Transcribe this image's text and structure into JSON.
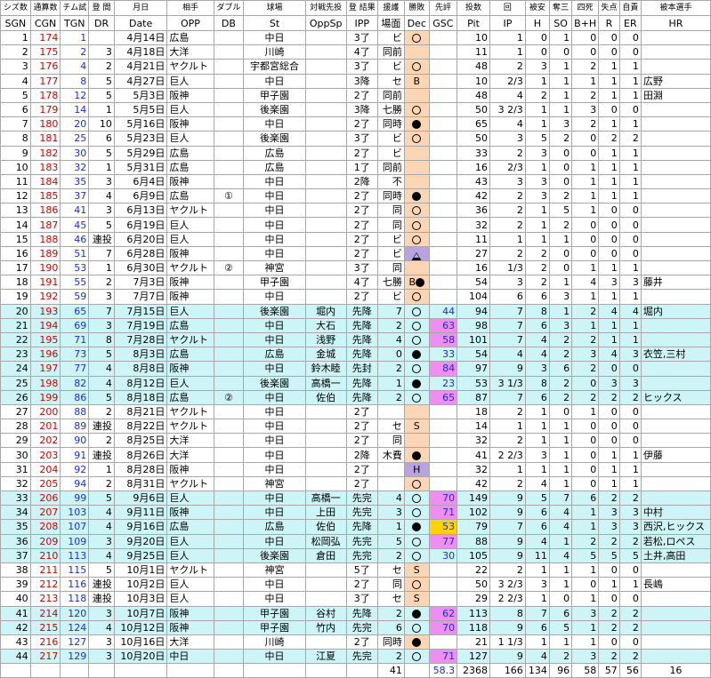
{
  "headers_top": [
    "シズ数",
    "通算数",
    "チム試",
    "登 間",
    "月日",
    "相手",
    "ダブル",
    "球場",
    "対戦先投",
    "登 結果",
    "援護",
    "勝敗",
    "先評",
    "投数",
    "回",
    "被安",
    "奪三",
    "四死",
    "失点",
    "自責",
    "被本選手"
  ],
  "headers": [
    "SGN",
    "CGN",
    "TGN",
    "DR",
    "Date",
    "OPP",
    "DB",
    "St",
    "OppSp",
    "IPP",
    "場面",
    "Dec",
    "GSC",
    "Pit",
    "IP",
    "H",
    "SO",
    "B+H",
    "R",
    "ER",
    "HR"
  ],
  "rows": [
    {
      "sgn": "1",
      "cgn": "174",
      "tgn": "1",
      "dr": "",
      "date": "4月14日",
      "opp": "広島",
      "db": "",
      "st": "中日",
      "oppsp": "",
      "ipp": "3了",
      "scene": "ビ",
      "dec": "loss",
      "gsc": "",
      "gcls": "",
      "pit": "10",
      "ip": "1",
      "h": "0",
      "so": "1",
      "bh": "0",
      "r": "0",
      "er": "0",
      "hr": "",
      "blue": false
    },
    {
      "sgn": "2",
      "cgn": "175",
      "tgn": "2",
      "dr": "3",
      "date": "4月18日",
      "opp": "大洋",
      "db": "",
      "st": "川崎",
      "oppsp": "",
      "ipp": "4了",
      "scene": "同前",
      "dec": "",
      "gsc": "",
      "gcls": "",
      "pit": "11",
      "ip": "1",
      "h": "0",
      "so": "0",
      "bh": "0",
      "r": "0",
      "er": "0",
      "hr": "",
      "blue": false
    },
    {
      "sgn": "3",
      "cgn": "176",
      "tgn": "4",
      "dr": "2",
      "date": "4月21日",
      "opp": "ヤクルト",
      "db": "",
      "st": "宇都宮総合",
      "oppsp": "",
      "ipp": "3了",
      "scene": "ビ",
      "dec": "loss",
      "gsc": "",
      "gcls": "",
      "pit": "48",
      "ip": "2",
      "h": "3",
      "so": "1",
      "bh": "2",
      "r": "1",
      "er": "1",
      "hr": "",
      "blue": false
    },
    {
      "sgn": "4",
      "cgn": "177",
      "tgn": "8",
      "dr": "5",
      "date": "4月27日",
      "opp": "巨人",
      "db": "",
      "st": "中日",
      "oppsp": "",
      "ipp": "3降",
      "scene": "セ",
      "dec": "B",
      "gsc": "",
      "gcls": "",
      "pit": "10",
      "ip": "2/3",
      "h": "1",
      "so": "1",
      "bh": "1",
      "r": "1",
      "er": "1",
      "hr": "広野",
      "blue": false
    },
    {
      "sgn": "5",
      "cgn": "178",
      "tgn": "12",
      "dr": "5",
      "date": "5月3日",
      "opp": "阪神",
      "db": "",
      "st": "甲子園",
      "oppsp": "",
      "ipp": "2了",
      "scene": "同前",
      "dec": "",
      "gsc": "",
      "gcls": "",
      "pit": "48",
      "ip": "4",
      "h": "2",
      "so": "1",
      "bh": "2",
      "r": "1",
      "er": "1",
      "hr": "田淵",
      "blue": false
    },
    {
      "sgn": "6",
      "cgn": "179",
      "tgn": "14",
      "dr": "1",
      "date": "5月5日",
      "opp": "巨人",
      "db": "",
      "st": "後楽園",
      "oppsp": "",
      "ipp": "3降",
      "scene": "七勝",
      "dec": "loss",
      "gsc": "",
      "gcls": "",
      "pit": "50",
      "ip": "3 2/3",
      "h": "1",
      "so": "1",
      "bh": "3",
      "r": "0",
      "er": "0",
      "hr": "",
      "blue": false
    },
    {
      "sgn": "7",
      "cgn": "180",
      "tgn": "20",
      "dr": "10",
      "date": "5月16日",
      "opp": "阪神",
      "db": "",
      "st": "中日",
      "oppsp": "",
      "ipp": "2了",
      "scene": "同時",
      "dec": "win",
      "gsc": "",
      "gcls": "",
      "pit": "65",
      "ip": "4",
      "h": "1",
      "so": "3",
      "bh": "2",
      "r": "1",
      "er": "1",
      "hr": "",
      "blue": false
    },
    {
      "sgn": "8",
      "cgn": "181",
      "tgn": "25",
      "dr": "6",
      "date": "5月23日",
      "opp": "巨人",
      "db": "",
      "st": "後楽園",
      "oppsp": "",
      "ipp": "3了",
      "scene": "ビ",
      "dec": "loss",
      "gsc": "",
      "gcls": "",
      "pit": "50",
      "ip": "3",
      "h": "5",
      "so": "2",
      "bh": "0",
      "r": "2",
      "er": "2",
      "hr": "",
      "blue": false
    },
    {
      "sgn": "9",
      "cgn": "182",
      "tgn": "30",
      "dr": "5",
      "date": "5月29日",
      "opp": "広島",
      "db": "",
      "st": "広島",
      "oppsp": "",
      "ipp": "2了",
      "scene": "ビ",
      "dec": "",
      "gsc": "",
      "gcls": "",
      "pit": "33",
      "ip": "2",
      "h": "3",
      "so": "0",
      "bh": "0",
      "r": "1",
      "er": "1",
      "hr": "",
      "blue": false
    },
    {
      "sgn": "10",
      "cgn": "183",
      "tgn": "32",
      "dr": "1",
      "date": "5月31日",
      "opp": "広島",
      "db": "",
      "st": "広島",
      "oppsp": "",
      "ipp": "1了",
      "scene": "同前",
      "dec": "",
      "gsc": "",
      "gcls": "",
      "pit": "16",
      "ip": "2/3",
      "h": "1",
      "so": "0",
      "bh": "1",
      "r": "1",
      "er": "1",
      "hr": "",
      "blue": false
    },
    {
      "sgn": "11",
      "cgn": "184",
      "tgn": "35",
      "dr": "3",
      "date": "6月4日",
      "opp": "阪神",
      "db": "",
      "st": "中日",
      "oppsp": "",
      "ipp": "2降",
      "scene": "不",
      "dec": "",
      "gsc": "",
      "gcls": "",
      "pit": "43",
      "ip": "3",
      "h": "3",
      "so": "0",
      "bh": "1",
      "r": "1",
      "er": "1",
      "hr": "",
      "blue": false
    },
    {
      "sgn": "12",
      "cgn": "185",
      "tgn": "37",
      "dr": "4",
      "date": "6月9日",
      "opp": "広島",
      "db": "①",
      "st": "中日",
      "oppsp": "",
      "ipp": "2了",
      "scene": "同時",
      "dec": "win",
      "gsc": "",
      "gcls": "",
      "pit": "42",
      "ip": "2",
      "h": "3",
      "so": "2",
      "bh": "1",
      "r": "1",
      "er": "1",
      "hr": "",
      "blue": false
    },
    {
      "sgn": "13",
      "cgn": "186",
      "tgn": "41",
      "dr": "3",
      "date": "6月13日",
      "opp": "ヤクルト",
      "db": "",
      "st": "中日",
      "oppsp": "",
      "ipp": "2了",
      "scene": "同",
      "dec": "loss",
      "gsc": "",
      "gcls": "",
      "pit": "36",
      "ip": "2",
      "h": "1",
      "so": "5",
      "bh": "1",
      "r": "0",
      "er": "0",
      "hr": "",
      "blue": false
    },
    {
      "sgn": "14",
      "cgn": "187",
      "tgn": "45",
      "dr": "5",
      "date": "6月19日",
      "opp": "巨人",
      "db": "",
      "st": "中日",
      "oppsp": "",
      "ipp": "2了",
      "scene": "同",
      "dec": "loss",
      "gsc": "",
      "gcls": "",
      "pit": "32",
      "ip": "2",
      "h": "1",
      "so": "2",
      "bh": "0",
      "r": "0",
      "er": "0",
      "hr": "",
      "blue": false
    },
    {
      "sgn": "15",
      "cgn": "188",
      "tgn": "46",
      "dr": "連投",
      "date": "6月20日",
      "opp": "巨人",
      "db": "",
      "st": "中日",
      "oppsp": "",
      "ipp": "2了",
      "scene": "ビ",
      "dec": "loss",
      "gsc": "",
      "gcls": "",
      "pit": "11",
      "ip": "1",
      "h": "1",
      "so": "1",
      "bh": "0",
      "r": "0",
      "er": "0",
      "hr": "",
      "blue": false
    },
    {
      "sgn": "16",
      "cgn": "189",
      "tgn": "51",
      "dr": "7",
      "date": "6月28日",
      "opp": "阪神",
      "db": "",
      "st": "中日",
      "oppsp": "",
      "ipp": "2了",
      "scene": "ビ",
      "dec": "draw",
      "gsc": "",
      "gcls": "",
      "pit": "27",
      "ip": "2",
      "h": "2",
      "so": "0",
      "bh": "0",
      "r": "0",
      "er": "0",
      "hr": "",
      "blue": false
    },
    {
      "sgn": "17",
      "cgn": "190",
      "tgn": "53",
      "dr": "1",
      "date": "6月30日",
      "opp": "ヤクルト",
      "db": "②",
      "st": "神宮",
      "oppsp": "",
      "ipp": "3了",
      "scene": "同",
      "dec": "",
      "gsc": "",
      "gcls": "",
      "pit": "16",
      "ip": "1/3",
      "h": "2",
      "so": "0",
      "bh": "1",
      "r": "1",
      "er": "1",
      "hr": "",
      "blue": false
    },
    {
      "sgn": "18",
      "cgn": "191",
      "tgn": "55",
      "dr": "2",
      "date": "7月3日",
      "opp": "阪神",
      "db": "",
      "st": "甲子園",
      "oppsp": "",
      "ipp": "4了",
      "scene": "七勝",
      "dec": "Bwin",
      "gsc": "",
      "gcls": "",
      "pit": "54",
      "ip": "3",
      "h": "2",
      "so": "1",
      "bh": "4",
      "r": "3",
      "er": "3",
      "hr": "藤井",
      "blue": false
    },
    {
      "sgn": "19",
      "cgn": "192",
      "tgn": "59",
      "dr": "3",
      "date": "7月7日",
      "opp": "阪神",
      "db": "",
      "st": "中日",
      "oppsp": "",
      "ipp": "2了",
      "scene": "ビ",
      "dec": "loss",
      "gsc": "",
      "gcls": "",
      "pit": "104",
      "ip": "6",
      "h": "6",
      "so": "3",
      "bh": "1",
      "r": "1",
      "er": "1",
      "hr": "",
      "blue": false
    },
    {
      "sgn": "20",
      "cgn": "193",
      "tgn": "65",
      "dr": "7",
      "date": "7月15日",
      "opp": "巨人",
      "db": "",
      "st": "後楽園",
      "oppsp": "堀内",
      "ipp": "先降",
      "scene": "7",
      "dec": "loss",
      "gsc": "44",
      "gcls": "",
      "pit": "94",
      "ip": "7",
      "h": "8",
      "so": "1",
      "bh": "2",
      "r": "4",
      "er": "4",
      "hr": "堀内",
      "blue": true
    },
    {
      "sgn": "21",
      "cgn": "194",
      "tgn": "69",
      "dr": "3",
      "date": "7月19日",
      "opp": "広島",
      "db": "",
      "st": "中日",
      "oppsp": "大石",
      "ipp": "先降",
      "scene": "2",
      "dec": "loss",
      "gsc": "63",
      "gcls": "m",
      "pit": "98",
      "ip": "7",
      "h": "6",
      "so": "3",
      "bh": "1",
      "r": "1",
      "er": "1",
      "hr": "",
      "blue": true
    },
    {
      "sgn": "22",
      "cgn": "195",
      "tgn": "71",
      "dr": "8",
      "date": "7月28日",
      "opp": "ヤクルト",
      "db": "",
      "st": "中日",
      "oppsp": "浅野",
      "ipp": "先降",
      "scene": "4",
      "dec": "loss",
      "gsc": "58",
      "gcls": "m",
      "pit": "101",
      "ip": "7",
      "h": "4",
      "so": "2",
      "bh": "2",
      "r": "1",
      "er": "1",
      "hr": "",
      "blue": true
    },
    {
      "sgn": "23",
      "cgn": "196",
      "tgn": "73",
      "dr": "5",
      "date": "8月3日",
      "opp": "広島",
      "db": "",
      "st": "広島",
      "oppsp": "金城",
      "ipp": "先降",
      "scene": "0",
      "dec": "win",
      "gsc": "33",
      "gcls": "",
      "pit": "54",
      "ip": "4",
      "h": "4",
      "so": "2",
      "bh": "3",
      "r": "4",
      "er": "3",
      "hr": "衣笠,三村",
      "blue": true
    },
    {
      "sgn": "24",
      "cgn": "197",
      "tgn": "77",
      "dr": "4",
      "date": "8月8日",
      "opp": "阪神",
      "db": "",
      "st": "中日",
      "oppsp": "鈴木睦",
      "ipp": "先封",
      "scene": "2",
      "dec": "loss",
      "gsc": "84",
      "gcls": "m",
      "pit": "97",
      "ip": "9",
      "h": "3",
      "so": "6",
      "bh": "2",
      "r": "0",
      "er": "0",
      "hr": "",
      "blue": true
    },
    {
      "sgn": "25",
      "cgn": "198",
      "tgn": "82",
      "dr": "4",
      "date": "8月12日",
      "opp": "巨人",
      "db": "",
      "st": "後楽園",
      "oppsp": "高橋一",
      "ipp": "先降",
      "scene": "1",
      "dec": "win",
      "gsc": "23",
      "gcls": "",
      "pit": "53",
      "ip": "3 1/3",
      "h": "8",
      "so": "2",
      "bh": "0",
      "r": "3",
      "er": "3",
      "hr": "",
      "blue": true
    },
    {
      "sgn": "26",
      "cgn": "199",
      "tgn": "86",
      "dr": "5",
      "date": "8月18日",
      "opp": "広島",
      "db": "②",
      "st": "中日",
      "oppsp": "佐伯",
      "ipp": "先降",
      "scene": "2",
      "dec": "loss",
      "gsc": "65",
      "gcls": "m",
      "pit": "87",
      "ip": "7",
      "h": "6",
      "so": "2",
      "bh": "2",
      "r": "2",
      "er": "2",
      "hr": "ヒックス",
      "blue": true
    },
    {
      "sgn": "27",
      "cgn": "200",
      "tgn": "88",
      "dr": "2",
      "date": "8月21日",
      "opp": "ヤクルト",
      "db": "",
      "st": "中日",
      "oppsp": "",
      "ipp": "2了",
      "scene": "",
      "dec": "",
      "gsc": "",
      "gcls": "",
      "pit": "18",
      "ip": "2",
      "h": "1",
      "so": "0",
      "bh": "1",
      "r": "0",
      "er": "0",
      "hr": "",
      "blue": false
    },
    {
      "sgn": "28",
      "cgn": "201",
      "tgn": "89",
      "dr": "連投",
      "date": "8月22日",
      "opp": "ヤクルト",
      "db": "",
      "st": "中日",
      "oppsp": "",
      "ipp": "2了",
      "scene": "セ",
      "dec": "S",
      "gsc": "",
      "gcls": "",
      "pit": "14",
      "ip": "1",
      "h": "1",
      "so": "1",
      "bh": "0",
      "r": "0",
      "er": "0",
      "hr": "",
      "blue": false
    },
    {
      "sgn": "29",
      "cgn": "202",
      "tgn": "90",
      "dr": "2",
      "date": "8月25日",
      "opp": "大洋",
      "db": "",
      "st": "中日",
      "oppsp": "",
      "ipp": "2了",
      "scene": "同",
      "dec": "",
      "gsc": "",
      "gcls": "",
      "pit": "32",
      "ip": "2",
      "h": "1",
      "so": "1",
      "bh": "0",
      "r": "0",
      "er": "0",
      "hr": "",
      "blue": false
    },
    {
      "sgn": "30",
      "cgn": "203",
      "tgn": "91",
      "dr": "連投",
      "date": "8月26日",
      "opp": "大洋",
      "db": "",
      "st": "中日",
      "oppsp": "",
      "ipp": "2降",
      "scene": "木費",
      "dec": "win",
      "gsc": "",
      "gcls": "",
      "pit": "41",
      "ip": "2 2/3",
      "h": "3",
      "so": "1",
      "bh": "0",
      "r": "1",
      "er": "1",
      "hr": "伊藤",
      "blue": false
    },
    {
      "sgn": "31",
      "cgn": "204",
      "tgn": "92",
      "dr": "1",
      "date": "8月28日",
      "opp": "阪神",
      "db": "",
      "st": "中日",
      "oppsp": "",
      "ipp": "2了",
      "scene": "",
      "dec": "H",
      "gsc": "",
      "gcls": "",
      "pit": "32",
      "ip": "1",
      "h": "1",
      "so": "1",
      "bh": "0",
      "r": "1",
      "er": "1",
      "hr": "",
      "blue": false
    },
    {
      "sgn": "32",
      "cgn": "205",
      "tgn": "94",
      "dr": "2",
      "date": "8月31日",
      "opp": "ヤクルト",
      "db": "",
      "st": "神宮",
      "oppsp": "",
      "ipp": "2了",
      "scene": "",
      "dec": "loss",
      "gsc": "",
      "gcls": "",
      "pit": "42",
      "ip": "2",
      "h": "4",
      "so": "1",
      "bh": "0",
      "r": "1",
      "er": "1",
      "hr": "",
      "blue": false
    },
    {
      "sgn": "33",
      "cgn": "206",
      "tgn": "99",
      "dr": "5",
      "date": "9月6日",
      "opp": "巨人",
      "db": "",
      "st": "中日",
      "oppsp": "高橋一",
      "ipp": "先完",
      "scene": "4",
      "dec": "loss",
      "gsc": "70",
      "gcls": "m",
      "pit": "149",
      "ip": "9",
      "h": "5",
      "so": "7",
      "bh": "6",
      "r": "2",
      "er": "2",
      "hr": "",
      "blue": true
    },
    {
      "sgn": "34",
      "cgn": "207",
      "tgn": "103",
      "dr": "4",
      "date": "9月11日",
      "opp": "阪神",
      "db": "",
      "st": "中日",
      "oppsp": "上田",
      "ipp": "先完",
      "scene": "3",
      "dec": "loss",
      "gsc": "71",
      "gcls": "m",
      "pit": "102",
      "ip": "9",
      "h": "6",
      "so": "4",
      "bh": "1",
      "r": "3",
      "er": "3",
      "hr": "中村",
      "blue": true
    },
    {
      "sgn": "35",
      "cgn": "208",
      "tgn": "107",
      "dr": "4",
      "date": "9月16日",
      "opp": "広島",
      "db": "",
      "st": "広島",
      "oppsp": "佐伯",
      "ipp": "先降",
      "scene": "1",
      "dec": "win",
      "gsc": "53",
      "gcls": "y",
      "pit": "79",
      "ip": "7",
      "h": "6",
      "so": "4",
      "bh": "1",
      "r": "3",
      "er": "3",
      "hr": "西沢,ヒックス",
      "blue": true
    },
    {
      "sgn": "36",
      "cgn": "209",
      "tgn": "109",
      "dr": "3",
      "date": "9月20日",
      "opp": "巨人",
      "db": "",
      "st": "中日",
      "oppsp": "松岡弘",
      "ipp": "先完",
      "scene": "5",
      "dec": "loss",
      "gsc": "77",
      "gcls": "m",
      "pit": "88",
      "ip": "9",
      "h": "4",
      "so": "1",
      "bh": "2",
      "r": "2",
      "er": "2",
      "hr": "若松,ロペス",
      "blue": true
    },
    {
      "sgn": "37",
      "cgn": "210",
      "tgn": "113",
      "dr": "4",
      "date": "9月25日",
      "opp": "巨人",
      "db": "",
      "st": "後楽園",
      "oppsp": "倉田",
      "ipp": "先完",
      "scene": "2",
      "dec": "loss",
      "gsc": "30",
      "gcls": "",
      "pit": "105",
      "ip": "9",
      "h": "11",
      "so": "4",
      "bh": "5",
      "r": "5",
      "er": "5",
      "hr": "土井,高田",
      "blue": true
    },
    {
      "sgn": "38",
      "cgn": "211",
      "tgn": "115",
      "dr": "5",
      "date": "10月1日",
      "opp": "ヤクルト",
      "db": "",
      "st": "神宮",
      "oppsp": "",
      "ipp": "5了",
      "scene": "セ",
      "dec": "S",
      "gsc": "",
      "gcls": "",
      "pit": "22",
      "ip": "2",
      "h": "1",
      "so": "1",
      "bh": "1",
      "r": "0",
      "er": "0",
      "hr": "",
      "blue": false
    },
    {
      "sgn": "39",
      "cgn": "212",
      "tgn": "116",
      "dr": "連投",
      "date": "10月2日",
      "opp": "巨人",
      "db": "",
      "st": "中日",
      "oppsp": "",
      "ipp": "2了",
      "scene": "同",
      "dec": "loss",
      "gsc": "",
      "gcls": "",
      "pit": "50",
      "ip": "3 2/3",
      "h": "3",
      "so": "1",
      "bh": "0",
      "r": "1",
      "er": "1",
      "hr": "長嶋",
      "blue": false
    },
    {
      "sgn": "40",
      "cgn": "213",
      "tgn": "118",
      "dr": "連投",
      "date": "10月3日",
      "opp": "巨人",
      "db": "",
      "st": "中日",
      "oppsp": "",
      "ipp": "3了",
      "scene": "セ",
      "dec": "S",
      "gsc": "",
      "gcls": "",
      "pit": "29",
      "ip": "2 2/3",
      "h": "1",
      "so": "0",
      "bh": "1",
      "r": "0",
      "er": "0",
      "hr": "",
      "blue": false
    },
    {
      "sgn": "41",
      "cgn": "214",
      "tgn": "120",
      "dr": "3",
      "date": "10月7日",
      "opp": "阪神",
      "db": "",
      "st": "甲子園",
      "oppsp": "谷村",
      "ipp": "先降",
      "scene": "2",
      "dec": "win",
      "gsc": "62",
      "gcls": "m",
      "pit": "113",
      "ip": "8",
      "h": "7",
      "so": "6",
      "bh": "3",
      "r": "2",
      "er": "2",
      "hr": "",
      "blue": true
    },
    {
      "sgn": "42",
      "cgn": "215",
      "tgn": "124",
      "dr": "4",
      "date": "10月12日",
      "opp": "阪神",
      "db": "",
      "st": "甲子園",
      "oppsp": "竹内",
      "ipp": "先完",
      "scene": "6",
      "dec": "loss",
      "gsc": "70",
      "gcls": "m",
      "pit": "118",
      "ip": "9",
      "h": "6",
      "so": "5",
      "bh": "1",
      "r": "2",
      "er": "2",
      "hr": "",
      "blue": true
    },
    {
      "sgn": "43",
      "cgn": "216",
      "tgn": "127",
      "dr": "3",
      "date": "10月16日",
      "opp": "大洋",
      "db": "",
      "st": "川崎",
      "oppsp": "",
      "ipp": "2了",
      "scene": "同時",
      "dec": "win",
      "gsc": "",
      "gcls": "",
      "pit": "21",
      "ip": "1 1/3",
      "h": "1",
      "so": "1",
      "bh": "1",
      "r": "0",
      "er": "0",
      "hr": "",
      "blue": false
    },
    {
      "sgn": "44",
      "cgn": "217",
      "tgn": "129",
      "dr": "3",
      "date": "10月20日",
      "opp": "中日",
      "db": "",
      "st": "中日",
      "oppsp": "江夏",
      "ipp": "先完",
      "scene": "2",
      "dec": "loss",
      "gsc": "71",
      "gcls": "m",
      "pit": "127",
      "ip": "9",
      "h": "4",
      "so": "2",
      "bh": "3",
      "r": "2",
      "er": "2",
      "hr": "",
      "blue": true
    }
  ],
  "totals": {
    "scene": "41",
    "gsc": "58.3",
    "pit": "2368",
    "ip": "166",
    "h": "134",
    "so": "96",
    "bh": "58",
    "r": "57",
    "er": "56",
    "hr": "16"
  }
}
